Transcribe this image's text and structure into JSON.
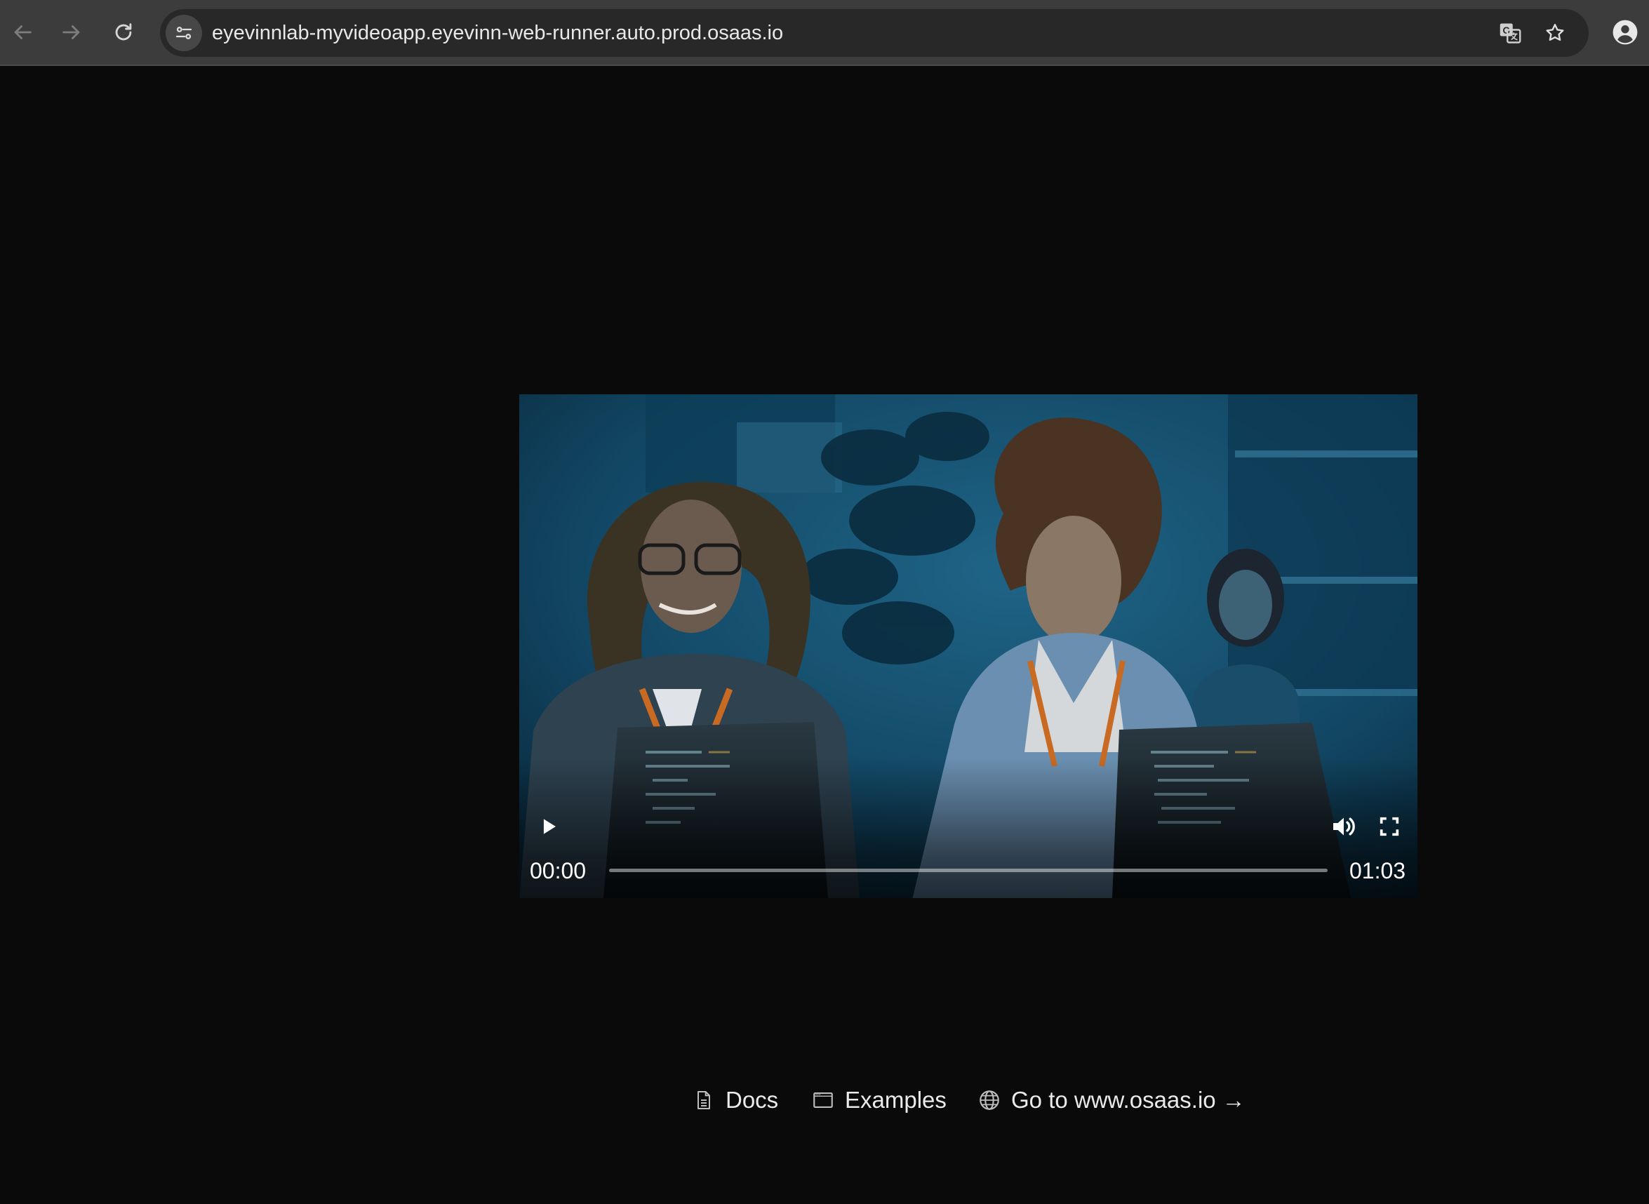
{
  "browser": {
    "url": "eyevinnlab-myvideoapp.eyevinn-web-runner.auto.prod.osaas.io",
    "icons": [
      "back-arrow-icon",
      "forward-arrow-icon",
      "reload-icon",
      "site-settings-icon",
      "translate-icon",
      "bookmark-star-icon",
      "profile-icon"
    ]
  },
  "player": {
    "current_time": "00:00",
    "duration": "01:03",
    "progress": 0,
    "icons": [
      "play-icon",
      "volume-icon",
      "fullscreen-icon"
    ]
  },
  "footer": {
    "links": [
      {
        "label": "Docs",
        "icon": "document-icon"
      },
      {
        "label": "Examples",
        "icon": "window-icon"
      },
      {
        "label": "Go to www.osaas.io →",
        "icon": "globe-icon"
      }
    ]
  },
  "colors": {
    "page_background": "#0a0a0a",
    "toolbar_background": "#3c3c3c",
    "omnibox_background": "#282828",
    "text": "#eaeaea"
  }
}
